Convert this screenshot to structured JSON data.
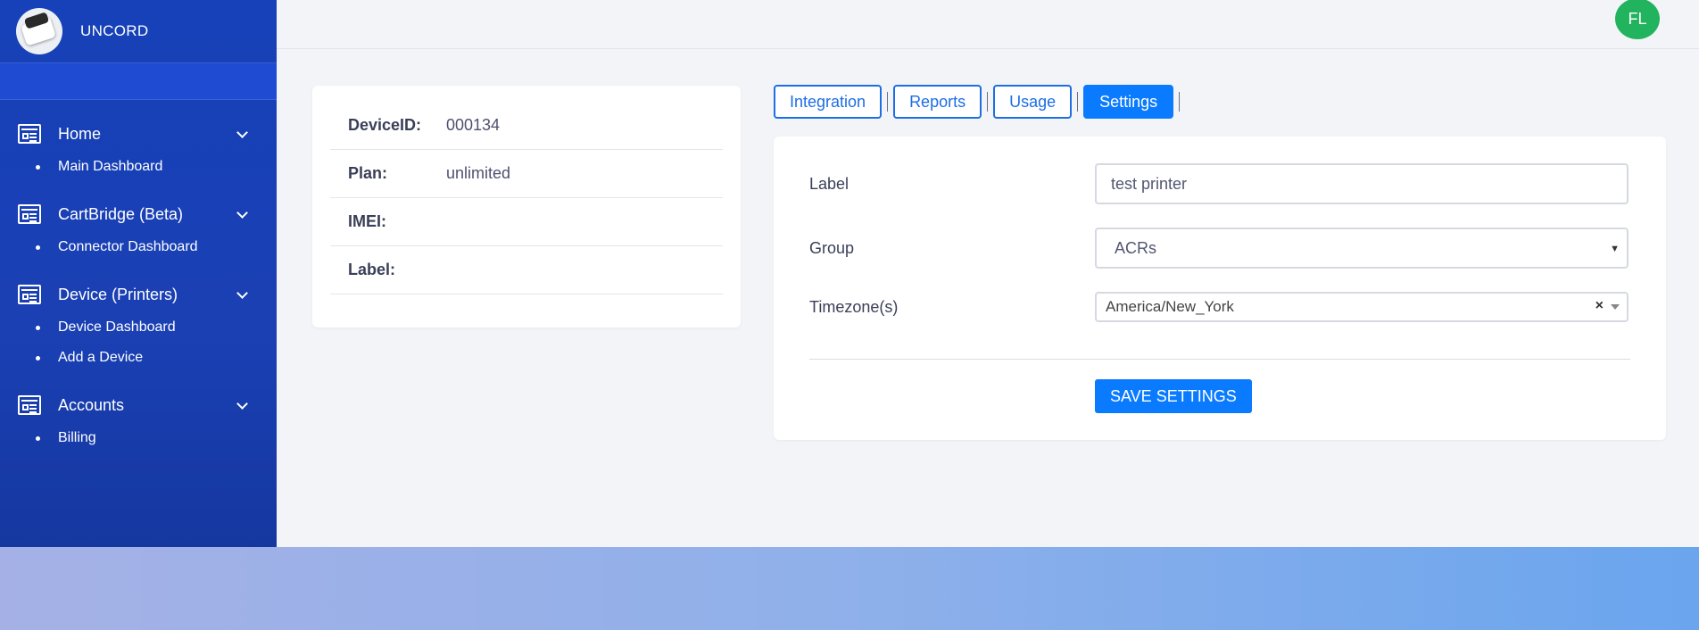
{
  "sidebar": {
    "brand": "UNCORD",
    "groups": [
      {
        "title": "Home",
        "items": [
          "Main Dashboard"
        ]
      },
      {
        "title": "CartBridge (Beta)",
        "items": [
          "Connector Dashboard"
        ]
      },
      {
        "title": "Device (Printers)",
        "items": [
          "Device Dashboard",
          "Add a Device"
        ]
      },
      {
        "title": "Accounts",
        "items": [
          "Billing"
        ]
      }
    ]
  },
  "header": {
    "avatar_initials": "FL",
    "avatar_color": "#22b35e"
  },
  "device_info": {
    "rows": [
      {
        "key": "DeviceID:",
        "value": "000134"
      },
      {
        "key": "Plan:",
        "value": "unlimited"
      },
      {
        "key": "IMEI:",
        "value": ""
      },
      {
        "key": "Label:",
        "value": ""
      }
    ]
  },
  "tabs": [
    {
      "label": "Integration",
      "active": false
    },
    {
      "label": "Reports",
      "active": false
    },
    {
      "label": "Usage",
      "active": false
    },
    {
      "label": "Settings",
      "active": true
    }
  ],
  "settings": {
    "label_field": {
      "label": "Label",
      "value": "test printer"
    },
    "group_field": {
      "label": "Group",
      "value": "ACRs"
    },
    "timezone_field": {
      "label": "Timezone(s)",
      "value": "America/New_York"
    },
    "save_label": "SAVE SETTINGS"
  },
  "colors": {
    "accent": "#0a7bff",
    "sidebar": "#1a40b4"
  }
}
